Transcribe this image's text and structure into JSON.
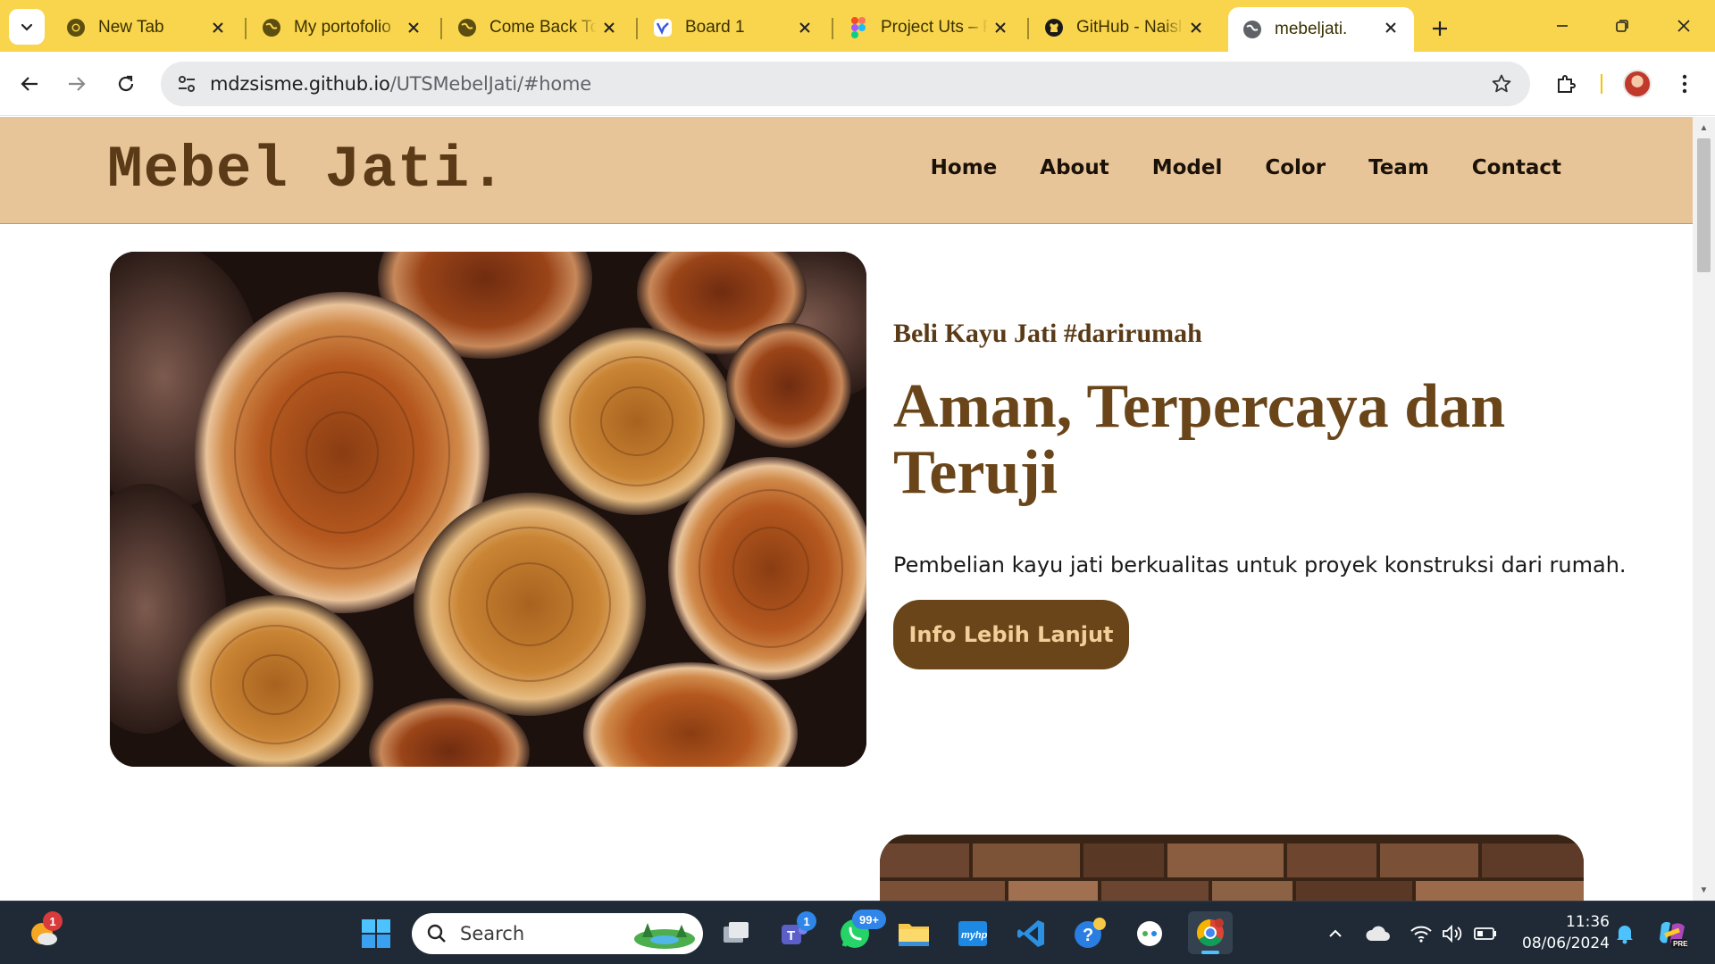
{
  "browser": {
    "tabs": [
      {
        "title": "New Tab",
        "icon": "chrome-icon"
      },
      {
        "title": "My portofolio",
        "icon": "globe-icon"
      },
      {
        "title": "Come Back To",
        "icon": "globe-icon"
      },
      {
        "title": "Board 1",
        "icon": "miro-icon"
      },
      {
        "title": "Project Uts – F",
        "icon": "figma-icon"
      },
      {
        "title": "GitHub - Naisl",
        "icon": "github-icon"
      },
      {
        "title": "mebeljati.",
        "icon": "globe-icon",
        "active": true
      }
    ],
    "url_host": "mdzsisme.github.io",
    "url_path": "/UTSMebelJati/#home",
    "accent_color": "#f8d54d"
  },
  "site": {
    "logo": "Mebel Jati.",
    "nav": [
      "Home",
      "About",
      "Model",
      "Color",
      "Team",
      "Contact"
    ],
    "hero": {
      "tagline": "Beli Kayu Jati #darirumah",
      "headline": "Aman, Terpercaya dan Teruji",
      "description": "Pembelian kayu jati berkualitas untuk proyek konstruksi dari rumah.",
      "cta": "Info Lebih Lanjut"
    },
    "colors": {
      "header_bg": "#e8c598",
      "brand_brown": "#6a4519",
      "cta_text": "#f2cf9a"
    }
  },
  "taskbar": {
    "search_placeholder": "Search",
    "badges": {
      "weather": "1",
      "teams": "1",
      "whatsapp": "99+"
    },
    "time": "11:36",
    "date": "08/06/2024"
  }
}
